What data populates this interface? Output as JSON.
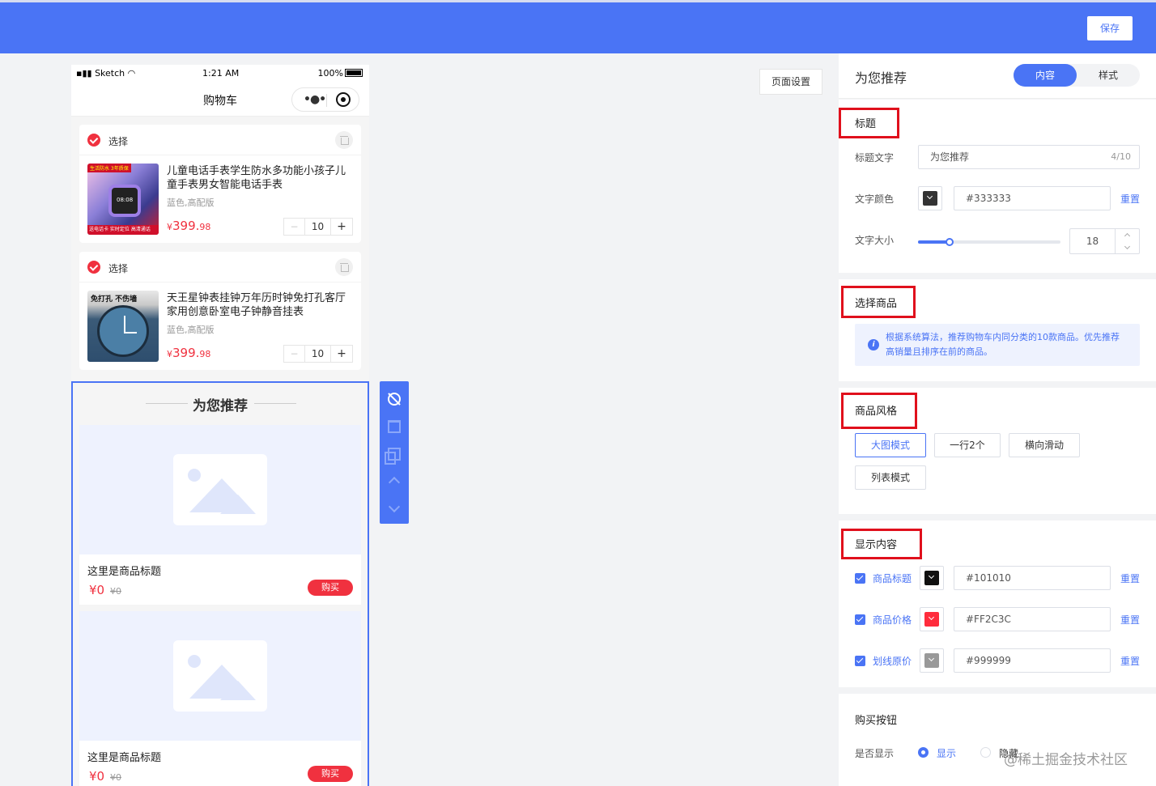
{
  "header": {
    "save_label": "保存",
    "accent": "#4a74f5"
  },
  "phone": {
    "status": {
      "carrier": "Sketch",
      "time": "1:21 AM",
      "battery": "100%"
    },
    "nav_title": "购物车",
    "cart_items": [
      {
        "select_label": "选择",
        "title": "儿童电话手表学生防水多功能小孩子儿童手表男女智能电话手表",
        "spec": "蓝色,高配版",
        "currency": "¥",
        "price_int": "399.",
        "price_dec": "98",
        "qty": "10",
        "thumb_badge": "生活防水 3年质保",
        "thumb_bottom": "送电话卡 实时定位 高清通话",
        "thumb_screen": "08:08"
      },
      {
        "select_label": "选择",
        "title": "天王星钟表挂钟万年历时钟免打孔客厅家用创意卧室电子钟静音挂表",
        "spec": "蓝色,高配版",
        "currency": "¥",
        "price_int": "399.",
        "price_dec": "98",
        "qty": "10",
        "thumb_label": "免打孔 不伤墙"
      }
    ],
    "stepper_minus": "−",
    "stepper_plus": "+"
  },
  "recommend": {
    "title": "为您推荐",
    "goods": [
      {
        "title": "这里是商品标题",
        "price": "¥0",
        "orig_price": "¥0",
        "buy_label": "购买"
      },
      {
        "title": "这里是商品标题",
        "price": "¥0",
        "orig_price": "¥0",
        "buy_label": "购买"
      }
    ]
  },
  "page_settings_label": "页面设置",
  "panel": {
    "title": "为您推荐",
    "tabs": [
      {
        "label": "内容",
        "active": true
      },
      {
        "label": "样式",
        "active": false
      }
    ],
    "title_section": {
      "heading": "标题",
      "text_label": "标题文字",
      "text_value": "为您推荐",
      "text_count": "4/10",
      "color_label": "文字颜色",
      "color_value": "#333333",
      "color_reset": "重置",
      "size_label": "文字大小",
      "size_value": "18",
      "size_fraction": 0.22
    },
    "goods_section": {
      "heading": "选择商品",
      "info": "根据系统算法，推荐购物车内同分类的10款商品。优先推荐高销量且排序在前的商品。"
    },
    "style_section": {
      "heading": "商品风格",
      "options": [
        {
          "label": "大图模式",
          "active": true
        },
        {
          "label": "一行2个",
          "active": false
        },
        {
          "label": "横向滑动",
          "active": false
        },
        {
          "label": "列表模式",
          "active": false
        }
      ]
    },
    "display_section": {
      "heading": "显示内容",
      "rows": [
        {
          "label": "商品标题",
          "color": "#101010",
          "value": "#101010",
          "reset": "重置"
        },
        {
          "label": "商品价格",
          "color": "#FF2C3C",
          "value": "#FF2C3C",
          "reset": "重置"
        },
        {
          "label": "划线原价",
          "color": "#999999",
          "value": "#999999",
          "reset": "重置"
        }
      ]
    },
    "buy_section": {
      "heading": "购买按钮",
      "show_label": "是否显示",
      "options": [
        {
          "label": "显示",
          "checked": true
        },
        {
          "label": "隐藏",
          "checked": false
        }
      ]
    }
  },
  "watermark": "@稀土掘金技术社区"
}
